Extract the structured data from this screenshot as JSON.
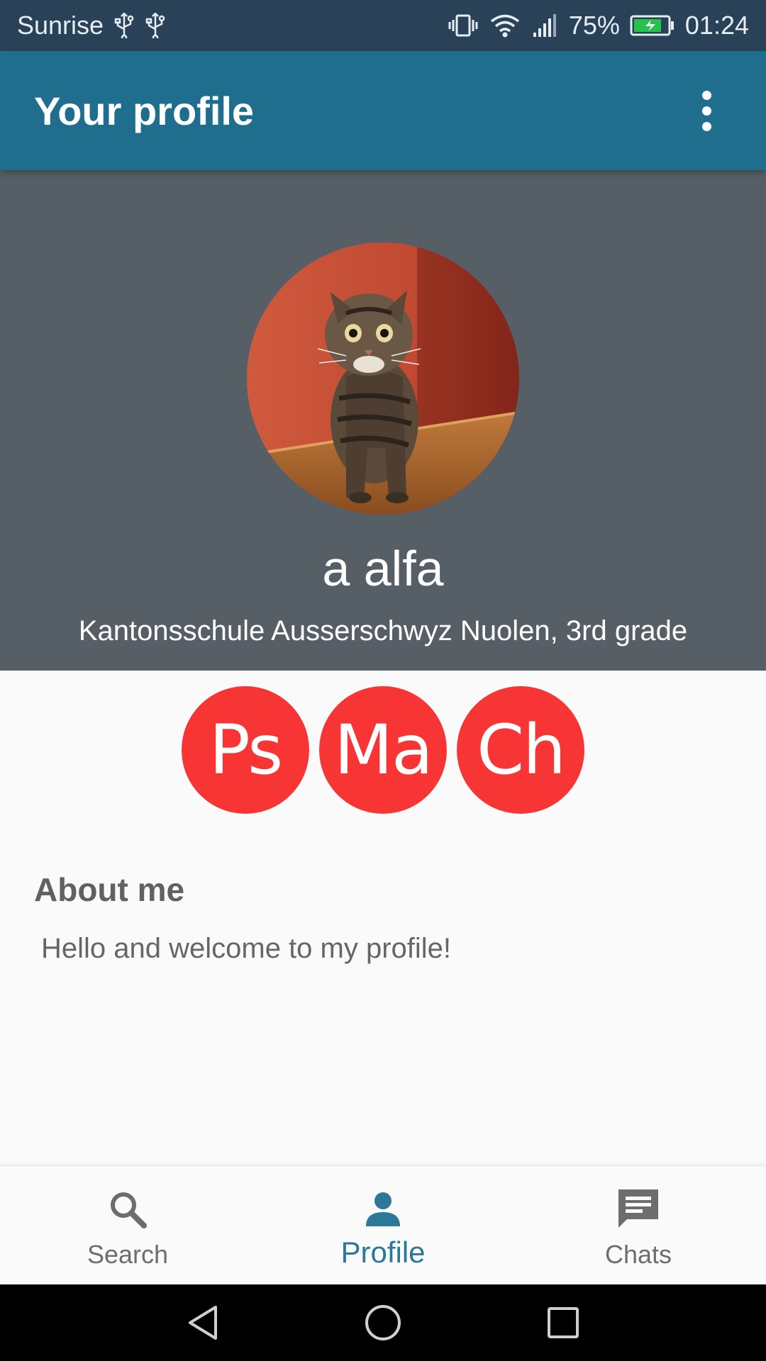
{
  "status_bar": {
    "carrier": "Sunrise",
    "battery": "75%",
    "time": "01:24",
    "icons": [
      "usb-icon",
      "usb-icon",
      "vibrate-icon",
      "wifi-icon",
      "signal-icon",
      "battery-charging-icon"
    ]
  },
  "app_bar": {
    "title": "Your profile",
    "menu_icon": "more-vert-icon"
  },
  "profile": {
    "avatar": "cat-photo",
    "name": "a alfa",
    "school": "Kantonsschule Ausserschwyz Nuolen, 3rd grade",
    "subjects": [
      "Ps",
      "Ma",
      "Ch"
    ],
    "subject_color": "#f73535"
  },
  "about": {
    "title": "About me",
    "text": "Hello and welcome to my profile!"
  },
  "bottom_nav": {
    "items": [
      {
        "label": "Search",
        "icon": "search-icon",
        "active": false
      },
      {
        "label": "Profile",
        "icon": "person-icon",
        "active": true
      },
      {
        "label": "Chats",
        "icon": "chat-icon",
        "active": false
      }
    ],
    "active_color": "#2b7899"
  },
  "system_nav": [
    "back-icon",
    "home-icon",
    "recents-icon"
  ],
  "colors": {
    "status_bar": "#294257",
    "app_bar": "#1f6e8e",
    "header": "#575f66"
  }
}
